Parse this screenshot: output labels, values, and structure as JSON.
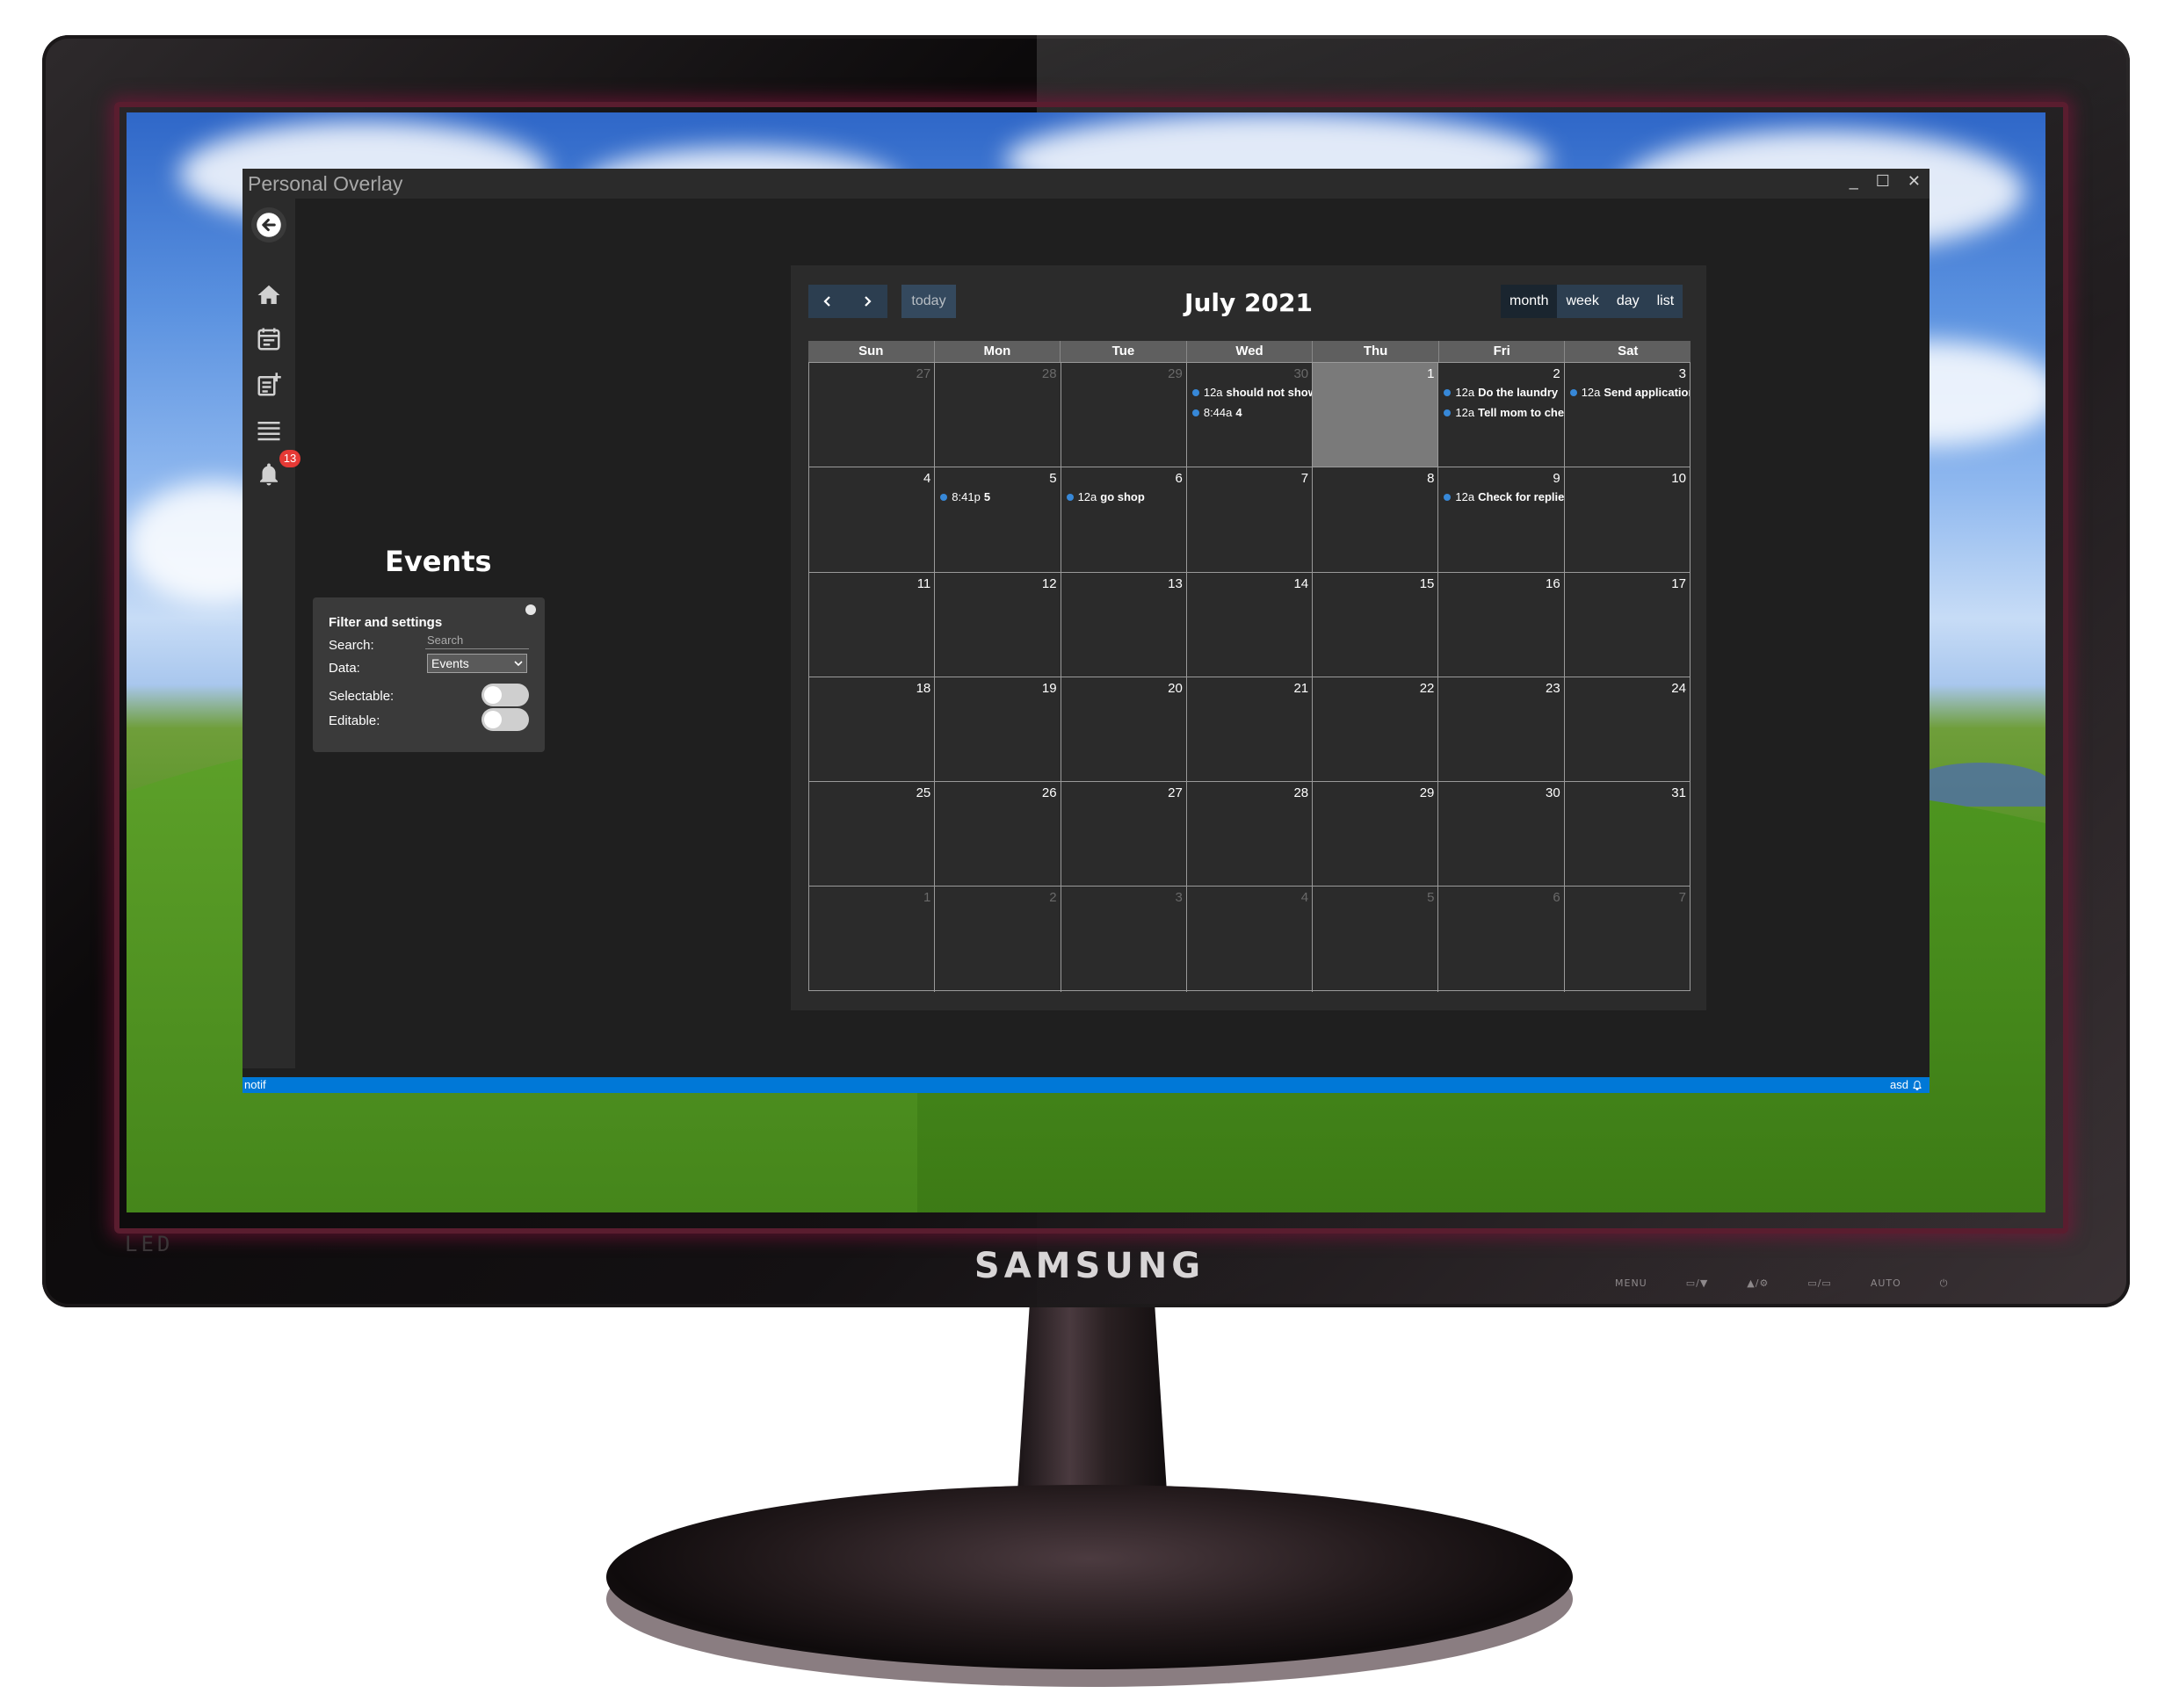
{
  "device": {
    "brand": "SAMSUNG",
    "led_label": "LED",
    "buttons": [
      "MENU",
      "▭/▼",
      "▲/⚙",
      "▭/▭",
      "AUTO",
      "⏻"
    ]
  },
  "window": {
    "title": "Personal Overlay",
    "controls": {
      "minimize": "_",
      "maximize": "☐",
      "close": "✕"
    }
  },
  "sidebar": {
    "items": [
      {
        "icon": "back-arrow-icon"
      },
      {
        "icon": "home-icon"
      },
      {
        "icon": "calendar-icon"
      },
      {
        "icon": "note-add-icon"
      },
      {
        "icon": "list-icon"
      },
      {
        "icon": "bell-icon",
        "badge": "13"
      }
    ]
  },
  "events_page": {
    "heading": "Events",
    "filter": {
      "title": "Filter and settings",
      "search_label": "Search:",
      "search_placeholder": "Search",
      "data_label": "Data:",
      "data_value": "Events",
      "selectable_label": "Selectable:",
      "selectable_on": false,
      "editable_label": "Editable:",
      "editable_on": false
    }
  },
  "calendar": {
    "title": "July 2021",
    "prev": "‹",
    "next": "›",
    "today_label": "today",
    "views": [
      "month",
      "week",
      "day",
      "list"
    ],
    "active_view": "month",
    "weekdays": [
      "Sun",
      "Mon",
      "Tue",
      "Wed",
      "Thu",
      "Fri",
      "Sat"
    ],
    "weeks": [
      [
        {
          "day": "27",
          "other": true,
          "events": []
        },
        {
          "day": "28",
          "other": true,
          "events": []
        },
        {
          "day": "29",
          "other": true,
          "events": []
        },
        {
          "day": "30",
          "other": true,
          "events": [
            {
              "time": "12a",
              "title": "should not show"
            },
            {
              "time": "8:44a",
              "title": "4"
            }
          ]
        },
        {
          "day": "1",
          "today": true,
          "events": []
        },
        {
          "day": "2",
          "events": [
            {
              "time": "12a",
              "title": "Do the laundry"
            },
            {
              "time": "12a",
              "title": "Tell mom to check"
            }
          ]
        },
        {
          "day": "3",
          "events": [
            {
              "time": "12a",
              "title": "Send application"
            }
          ]
        }
      ],
      [
        {
          "day": "4",
          "events": []
        },
        {
          "day": "5",
          "events": [
            {
              "time": "8:41p",
              "title": "5"
            }
          ]
        },
        {
          "day": "6",
          "events": [
            {
              "time": "12a",
              "title": "go shop"
            }
          ]
        },
        {
          "day": "7",
          "events": []
        },
        {
          "day": "8",
          "events": []
        },
        {
          "day": "9",
          "events": [
            {
              "time": "12a",
              "title": "Check for replies"
            }
          ]
        },
        {
          "day": "10",
          "events": []
        }
      ],
      [
        {
          "day": "11",
          "events": []
        },
        {
          "day": "12",
          "events": []
        },
        {
          "day": "13",
          "events": []
        },
        {
          "day": "14",
          "events": []
        },
        {
          "day": "15",
          "events": []
        },
        {
          "day": "16",
          "events": []
        },
        {
          "day": "17",
          "events": []
        }
      ],
      [
        {
          "day": "18",
          "events": []
        },
        {
          "day": "19",
          "events": []
        },
        {
          "day": "20",
          "events": []
        },
        {
          "day": "21",
          "events": []
        },
        {
          "day": "22",
          "events": []
        },
        {
          "day": "23",
          "events": []
        },
        {
          "day": "24",
          "events": []
        }
      ],
      [
        {
          "day": "25",
          "events": []
        },
        {
          "day": "26",
          "events": []
        },
        {
          "day": "27",
          "events": []
        },
        {
          "day": "28",
          "events": []
        },
        {
          "day": "29",
          "events": []
        },
        {
          "day": "30",
          "events": []
        },
        {
          "day": "31",
          "events": []
        }
      ],
      [
        {
          "day": "1",
          "other": true,
          "events": []
        },
        {
          "day": "2",
          "other": true,
          "events": []
        },
        {
          "day": "3",
          "other": true,
          "events": []
        },
        {
          "day": "4",
          "other": true,
          "events": []
        },
        {
          "day": "5",
          "other": true,
          "events": []
        },
        {
          "day": "6",
          "other": true,
          "events": []
        },
        {
          "day": "7",
          "other": true,
          "events": []
        }
      ]
    ]
  },
  "statusbar": {
    "left": "notif",
    "right": "asd"
  },
  "colors": {
    "status_bar": "#0078d7",
    "event_dot": "#3788d8",
    "button_bg": "#2c3e50",
    "badge": "#e53935"
  }
}
